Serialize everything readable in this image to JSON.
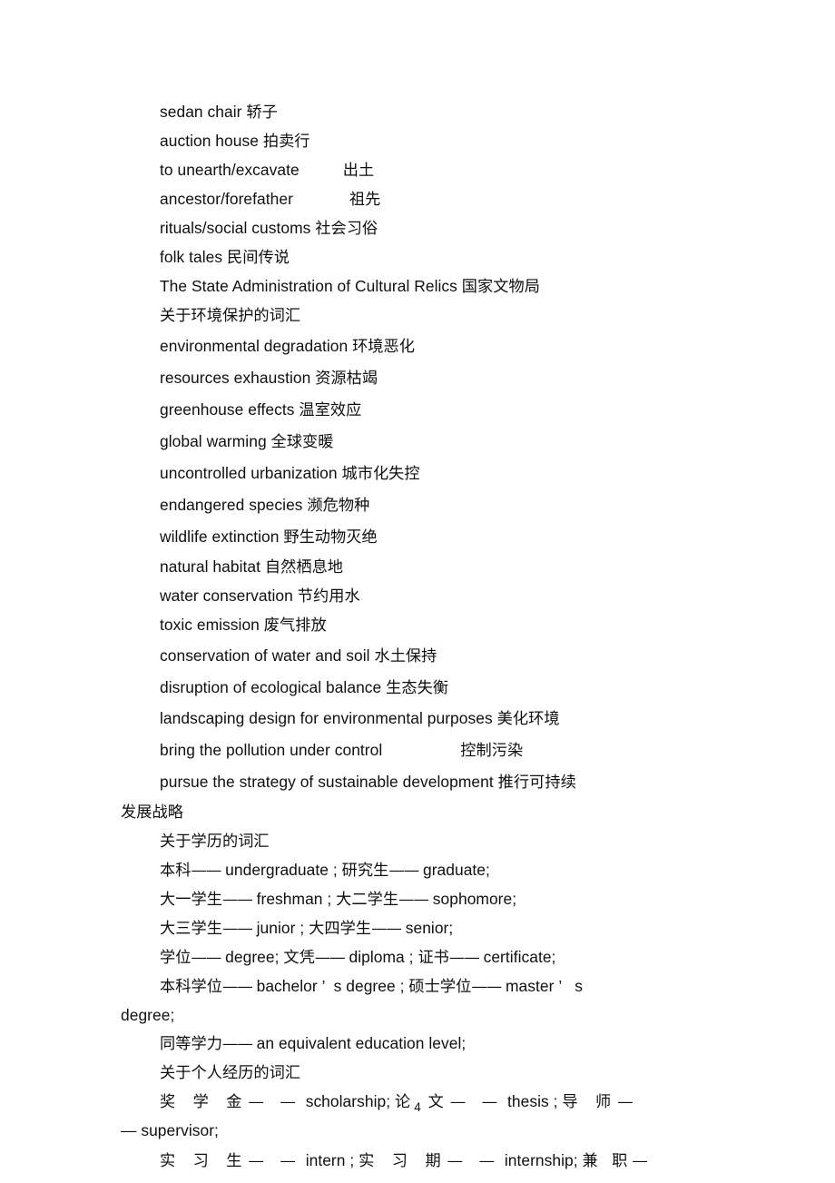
{
  "document": {
    "page_number": "4",
    "sections": [
      {
        "id": "cultural-relics",
        "entries": [
          {
            "en": "sedan chair ",
            "zh": "轿子"
          },
          {
            "en": "auction house ",
            "zh": "拍卖行"
          },
          {
            "en": "to unearth/excavate",
            "zh": "出土",
            "tab": "a"
          },
          {
            "en": "ancestor/forefather",
            "zh": "祖先",
            "tab": "a"
          },
          {
            "en": "rituals/social customs ",
            "zh": "社会习俗"
          },
          {
            "en": "folk tales ",
            "zh": "民间传说"
          },
          {
            "en": "The State Administration of Cultural Relics ",
            "zh": "国家文物局"
          }
        ]
      },
      {
        "id": "environment",
        "heading": "关于环境保护的词汇",
        "entries": [
          {
            "en": "environmental degradation ",
            "zh": "环境恶化"
          },
          {
            "en": "resources exhaustion ",
            "zh": "资源枯竭"
          },
          {
            "en": "greenhouse effects ",
            "zh": "温室效应"
          },
          {
            "en": "global warming ",
            "zh": "全球变暖"
          },
          {
            "en": "uncontrolled urbanization ",
            "zh": "城市化失控"
          },
          {
            "en": "endangered species ",
            "zh": "濒危物种"
          },
          {
            "en": "wildlife extinction ",
            "zh": "野生动物灭绝"
          },
          {
            "en": "natural habitat ",
            "zh": "自然栖息地"
          },
          {
            "en": "water conservation ",
            "zh": "节约用水"
          },
          {
            "en": "toxic emission ",
            "zh": "废气排放"
          },
          {
            "en": "conservation of water and soil ",
            "zh": "水土保持"
          },
          {
            "en": "disruption of ecological balance ",
            "zh": "生态失衡"
          },
          {
            "en": "landscaping design for environmental purposes ",
            "zh": "美化环境"
          },
          {
            "en": "bring the pollution under control",
            "zh": "控制污染",
            "tab": "b"
          },
          {
            "en": "pursue the strategy of sustainable development ",
            "zh": "推行可持续",
            "wrap": "发展战略"
          }
        ]
      },
      {
        "id": "education-degrees",
        "heading": "关于学历的词汇",
        "lines": [
          {
            "pairs": [
              {
                "zh": "本科",
                "dash": "——",
                "en": " undergraduate",
                "sep": " ; "
              },
              {
                "zh": "研究生",
                "dash": "——",
                "en": " graduate;",
                "sep": ""
              }
            ]
          },
          {
            "pairs": [
              {
                "zh": "大一学生",
                "dash": "——",
                "en": " freshman",
                "sep": " ; "
              },
              {
                "zh": "大二学生",
                "dash": "——",
                "en": " sophomore;",
                "sep": ""
              }
            ]
          },
          {
            "pairs": [
              {
                "zh": "大三学生",
                "dash": "——",
                "en": " junior",
                "sep": " ; "
              },
              {
                "zh": "大四学生",
                "dash": "——",
                "en": " senior;",
                "sep": ""
              }
            ]
          },
          {
            "pairs": [
              {
                "zh": "学位",
                "dash": "——",
                "en": " degree;",
                "sep": " "
              },
              {
                "zh": "文凭",
                "dash": "——",
                "en": " diploma",
                "sep": " ; "
              },
              {
                "zh": "证书",
                "dash": "——",
                "en": " certificate;",
                "sep": ""
              }
            ]
          },
          {
            "pairs": [
              {
                "zh": "本科学位",
                "dash": "——",
                "en": " bachelor ’  s degree",
                "sep": " ; "
              },
              {
                "zh": "硕士学位",
                "dash": "——",
                "en": " master ’   s",
                "sep": ""
              }
            ],
            "wrap": "degree;"
          },
          {
            "pairs": [
              {
                "zh": "同等学力",
                "dash": "——",
                "en": " an equivalent education level;",
                "sep": ""
              }
            ]
          }
        ]
      },
      {
        "id": "personal-experience",
        "heading": "关于个人经历的词汇",
        "lines": [
          {
            "spread": true,
            "segments": [
              {
                "type": "zh-spread",
                "text": "奖 学 金"
              },
              {
                "type": "dash-wide",
                "text": "— —"
              },
              {
                "type": "en",
                "text": " scholarship; "
              },
              {
                "type": "zh-spread",
                "text": "论 文"
              },
              {
                "type": "dash-wide",
                "text": "— —"
              },
              {
                "type": "en",
                "text": " thesis ; "
              },
              {
                "type": "zh-spread",
                "text": "导 师"
              },
              {
                "type": "dash-wide",
                "text": "—"
              }
            ],
            "wrap": "— supervisor;"
          },
          {
            "spread": true,
            "segments": [
              {
                "type": "zh-spread",
                "text": "实 习 生"
              },
              {
                "type": "dash-wide",
                "text": "— —"
              },
              {
                "type": "en",
                "text": " intern ; "
              },
              {
                "type": "zh-spread",
                "text": "实 习 期"
              },
              {
                "type": "dash-wide",
                "text": "— —"
              },
              {
                "type": "en",
                "text": " internship; "
              },
              {
                "type": "zh-spread",
                "text": "兼 职"
              },
              {
                "type": "dash-wide",
                "text": "—"
              }
            ]
          }
        ]
      }
    ]
  }
}
